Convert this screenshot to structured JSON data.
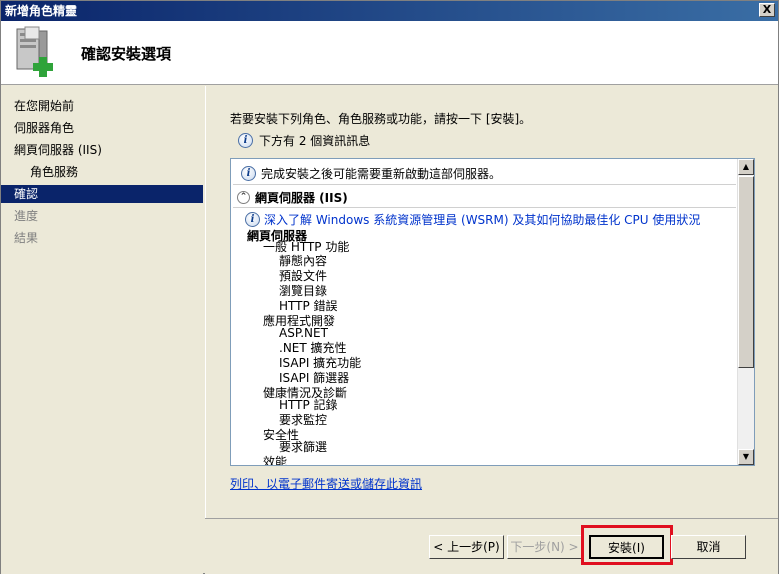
{
  "window": {
    "title": "新增角色精靈",
    "close_glyph": "X"
  },
  "header": {
    "title": "確認安裝選項",
    "icon": "server-add-icon"
  },
  "sidebar": {
    "items": [
      {
        "label": "在您開始前",
        "state": "normal"
      },
      {
        "label": "伺服器角色",
        "state": "normal"
      },
      {
        "label": "網頁伺服器 (IIS)",
        "state": "normal"
      },
      {
        "label": "角色服務",
        "state": "normal",
        "sub": true
      },
      {
        "label": "確認",
        "state": "active"
      },
      {
        "label": "進度",
        "state": "disabled"
      },
      {
        "label": "結果",
        "state": "disabled"
      }
    ]
  },
  "main": {
    "intro": "若要安裝下列角色、角色服務或功能，請按一下 [安裝]。",
    "info_count": "下方有 2 個資訊訊息",
    "list": {
      "restart_notice": "完成安裝之後可能需要重新啟動這部伺服器。",
      "section_title": "網頁伺服器 (IIS)",
      "link_text": "深入了解 Windows 系統資源管理員 (WSRM) 及其如何協助最佳化 CPU 使用狀況",
      "tree": [
        {
          "label": "網頁伺服器",
          "level": 0
        },
        {
          "label": "一般 HTTP 功能",
          "level": 1
        },
        {
          "label": "靜態內容",
          "level": 2
        },
        {
          "label": "預設文件",
          "level": 2
        },
        {
          "label": "瀏覽目錄",
          "level": 2
        },
        {
          "label": "HTTP 錯誤",
          "level": 2
        },
        {
          "label": "應用程式開發",
          "level": 1
        },
        {
          "label": "ASP.NET",
          "level": 2
        },
        {
          "label": ".NET 擴充性",
          "level": 2
        },
        {
          "label": "ISAPI 擴充功能",
          "level": 2
        },
        {
          "label": "ISAPI 篩選器",
          "level": 2
        },
        {
          "label": "健康情況及診斷",
          "level": 1
        },
        {
          "label": "HTTP 記錄",
          "level": 2
        },
        {
          "label": "要求監控",
          "level": 2
        },
        {
          "label": "安全性",
          "level": 1
        },
        {
          "label": "要求篩選",
          "level": 2
        },
        {
          "label": "效能",
          "level": 1
        }
      ]
    },
    "print_link": "列印、以電子郵件寄送或儲存此資訊"
  },
  "footer": {
    "prev_label": "< 上一步(P)",
    "next_label": "下一步(N) >",
    "install_label": "安裝(I)",
    "cancel_label": "取消"
  },
  "colors": {
    "highlight": "#e01020",
    "selected_nav": "#0a246a",
    "link": "#0033cc"
  }
}
